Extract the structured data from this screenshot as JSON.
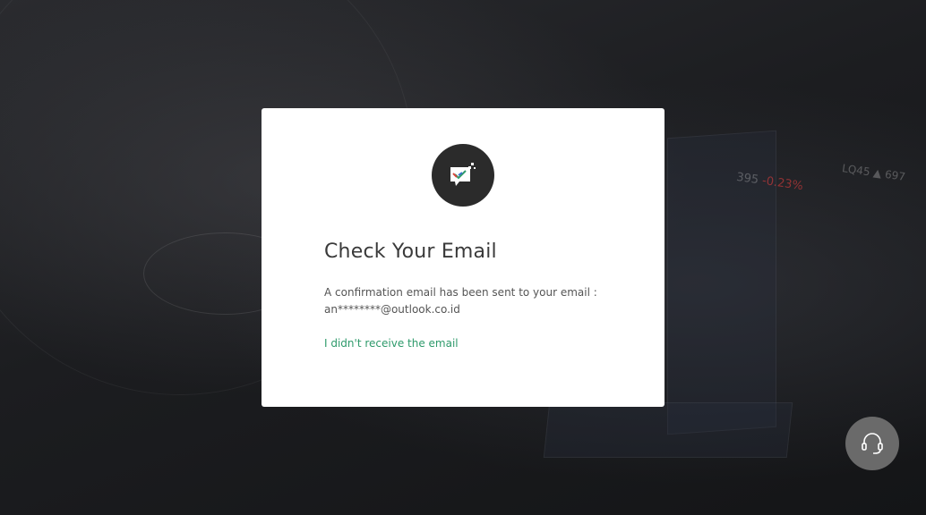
{
  "background": {
    "ticker_1_value": "395",
    "ticker_1_change": "-0.23%",
    "ticker_2": "LQ45 ▲ 697"
  },
  "modal": {
    "icon": "email-check-icon",
    "title": "Check Your Email",
    "message_line_1": "A confirmation email has been sent to your email :",
    "email": "an********@outlook.co.id",
    "resend_link": "I didn't receive the email"
  },
  "support": {
    "icon": "headset-icon"
  },
  "colors": {
    "link": "#2e9a6b",
    "icon_circle": "#2b2b2b",
    "support_button": "#6a6a6a"
  }
}
